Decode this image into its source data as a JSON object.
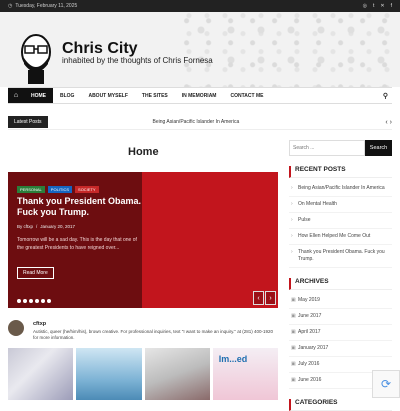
{
  "topbar": {
    "date": "Tuesday, February 11, 2025"
  },
  "site": {
    "title": "Chris City",
    "description": "inhabited by the thoughts of Chris Fornesa"
  },
  "nav": {
    "items": [
      "HOME",
      "BLOG",
      "ABOUT MYSELF",
      "THE SITES",
      "IN MEMORIAM",
      "CONTACT ME"
    ]
  },
  "latest": {
    "label": "Latest Posts",
    "ticker": "Being Asian/Pacific Islander In America"
  },
  "main": {
    "title": "Home"
  },
  "slide": {
    "tags": [
      "PERSONAL",
      "POLITICS",
      "SOCIETY"
    ],
    "title": "Thank you President Obama. Fuck you Trump.",
    "author": "By cftxp",
    "sep": "/",
    "date": "January 20, 2017",
    "excerpt": "Tomorrow will be a sad day.  This is the day that one of the greatest Presidents to have reigned over...",
    "read_more": "Read More"
  },
  "profile": {
    "name": "cftxp",
    "bio": "Autistic, queer (he/him/his), brown creative. For professional inquiries, text \"I want to make an inquiry.\" at (281) 400-1920 for more information."
  },
  "grid": {
    "caption": "Im...ed"
  },
  "sidebar": {
    "search_placeholder": "Search ...",
    "search_button": "Search",
    "recent_title": "RECENT POSTS",
    "recent": [
      "Being Asian/Pacific Islander In America",
      "On Mental Health",
      "Pulse",
      "How Ellen Helped Me Come Out",
      "Thank you President Obama. Fuck you Trump."
    ],
    "archives_title": "ARCHIVES",
    "archives": [
      "May 2019",
      "June 2017",
      "April 2017",
      "January 2017",
      "July 2016",
      "June 2016"
    ],
    "categories_title": "CATEGORIES"
  },
  "colors": {
    "accent": "#c2151d",
    "dark": "#111111",
    "slide_dark": "#6d0d10"
  }
}
